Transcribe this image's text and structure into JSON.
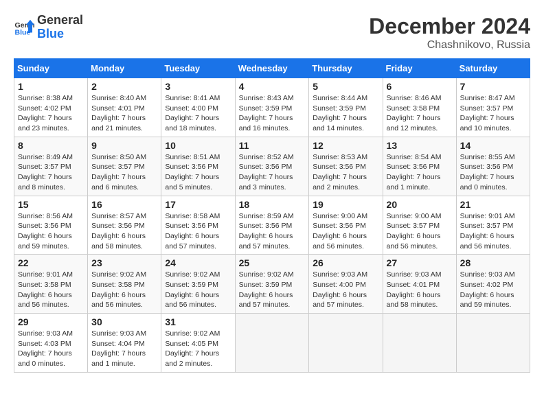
{
  "header": {
    "logo_line1": "General",
    "logo_line2": "Blue",
    "month_year": "December 2024",
    "location": "Chashnikovo, Russia"
  },
  "days_of_week": [
    "Sunday",
    "Monday",
    "Tuesday",
    "Wednesday",
    "Thursday",
    "Friday",
    "Saturday"
  ],
  "weeks": [
    [
      {
        "day": "1",
        "sunrise": "8:38 AM",
        "sunset": "4:02 PM",
        "daylight": "7 hours and 23 minutes."
      },
      {
        "day": "2",
        "sunrise": "8:40 AM",
        "sunset": "4:01 PM",
        "daylight": "7 hours and 21 minutes."
      },
      {
        "day": "3",
        "sunrise": "8:41 AM",
        "sunset": "4:00 PM",
        "daylight": "7 hours and 18 minutes."
      },
      {
        "day": "4",
        "sunrise": "8:43 AM",
        "sunset": "3:59 PM",
        "daylight": "7 hours and 16 minutes."
      },
      {
        "day": "5",
        "sunrise": "8:44 AM",
        "sunset": "3:59 PM",
        "daylight": "7 hours and 14 minutes."
      },
      {
        "day": "6",
        "sunrise": "8:46 AM",
        "sunset": "3:58 PM",
        "daylight": "7 hours and 12 minutes."
      },
      {
        "day": "7",
        "sunrise": "8:47 AM",
        "sunset": "3:57 PM",
        "daylight": "7 hours and 10 minutes."
      }
    ],
    [
      {
        "day": "8",
        "sunrise": "8:49 AM",
        "sunset": "3:57 PM",
        "daylight": "7 hours and 8 minutes."
      },
      {
        "day": "9",
        "sunrise": "8:50 AM",
        "sunset": "3:57 PM",
        "daylight": "7 hours and 6 minutes."
      },
      {
        "day": "10",
        "sunrise": "8:51 AM",
        "sunset": "3:56 PM",
        "daylight": "7 hours and 5 minutes."
      },
      {
        "day": "11",
        "sunrise": "8:52 AM",
        "sunset": "3:56 PM",
        "daylight": "7 hours and 3 minutes."
      },
      {
        "day": "12",
        "sunrise": "8:53 AM",
        "sunset": "3:56 PM",
        "daylight": "7 hours and 2 minutes."
      },
      {
        "day": "13",
        "sunrise": "8:54 AM",
        "sunset": "3:56 PM",
        "daylight": "7 hours and 1 minute."
      },
      {
        "day": "14",
        "sunrise": "8:55 AM",
        "sunset": "3:56 PM",
        "daylight": "7 hours and 0 minutes."
      }
    ],
    [
      {
        "day": "15",
        "sunrise": "8:56 AM",
        "sunset": "3:56 PM",
        "daylight": "6 hours and 59 minutes."
      },
      {
        "day": "16",
        "sunrise": "8:57 AM",
        "sunset": "3:56 PM",
        "daylight": "6 hours and 58 minutes."
      },
      {
        "day": "17",
        "sunrise": "8:58 AM",
        "sunset": "3:56 PM",
        "daylight": "6 hours and 57 minutes."
      },
      {
        "day": "18",
        "sunrise": "8:59 AM",
        "sunset": "3:56 PM",
        "daylight": "6 hours and 57 minutes."
      },
      {
        "day": "19",
        "sunrise": "9:00 AM",
        "sunset": "3:56 PM",
        "daylight": "6 hours and 56 minutes."
      },
      {
        "day": "20",
        "sunrise": "9:00 AM",
        "sunset": "3:57 PM",
        "daylight": "6 hours and 56 minutes."
      },
      {
        "day": "21",
        "sunrise": "9:01 AM",
        "sunset": "3:57 PM",
        "daylight": "6 hours and 56 minutes."
      }
    ],
    [
      {
        "day": "22",
        "sunrise": "9:01 AM",
        "sunset": "3:58 PM",
        "daylight": "6 hours and 56 minutes."
      },
      {
        "day": "23",
        "sunrise": "9:02 AM",
        "sunset": "3:58 PM",
        "daylight": "6 hours and 56 minutes."
      },
      {
        "day": "24",
        "sunrise": "9:02 AM",
        "sunset": "3:59 PM",
        "daylight": "6 hours and 56 minutes."
      },
      {
        "day": "25",
        "sunrise": "9:02 AM",
        "sunset": "3:59 PM",
        "daylight": "6 hours and 57 minutes."
      },
      {
        "day": "26",
        "sunrise": "9:03 AM",
        "sunset": "4:00 PM",
        "daylight": "6 hours and 57 minutes."
      },
      {
        "day": "27",
        "sunrise": "9:03 AM",
        "sunset": "4:01 PM",
        "daylight": "6 hours and 58 minutes."
      },
      {
        "day": "28",
        "sunrise": "9:03 AM",
        "sunset": "4:02 PM",
        "daylight": "6 hours and 59 minutes."
      }
    ],
    [
      {
        "day": "29",
        "sunrise": "9:03 AM",
        "sunset": "4:03 PM",
        "daylight": "7 hours and 0 minutes."
      },
      {
        "day": "30",
        "sunrise": "9:03 AM",
        "sunset": "4:04 PM",
        "daylight": "7 hours and 1 minute."
      },
      {
        "day": "31",
        "sunrise": "9:02 AM",
        "sunset": "4:05 PM",
        "daylight": "7 hours and 2 minutes."
      },
      null,
      null,
      null,
      null
    ]
  ]
}
